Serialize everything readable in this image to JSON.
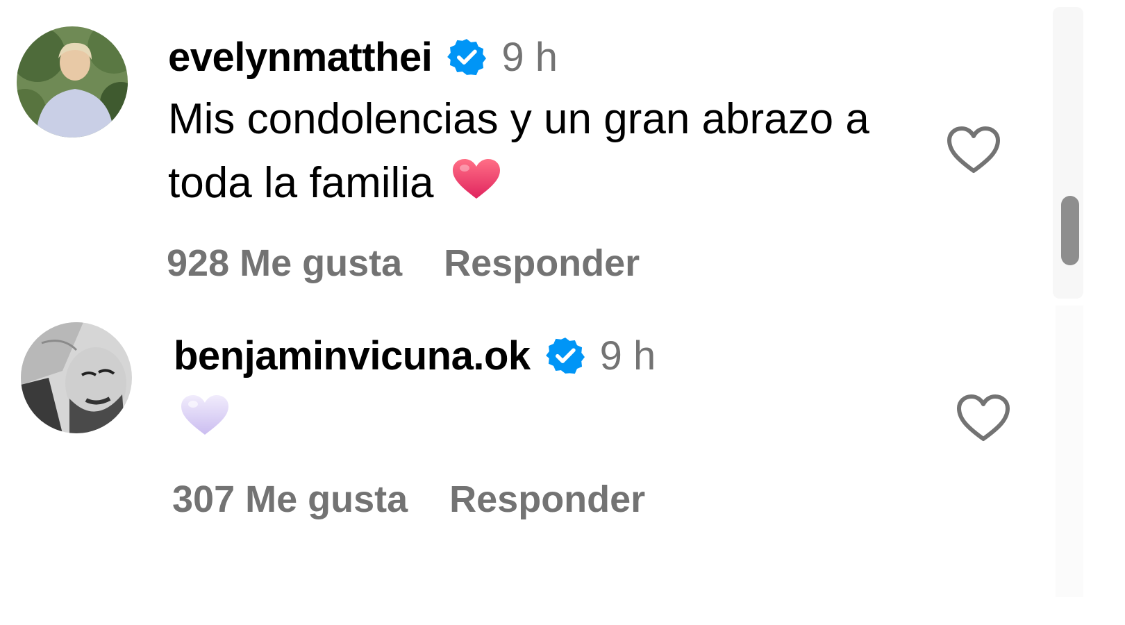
{
  "comments": [
    {
      "username": "evelynmatthei",
      "verified": true,
      "time": "9 h",
      "text": "Mis condolencias y un gran abrazo a toda la familia",
      "emoji": "red-heart",
      "likes_label": "928 Me gusta",
      "reply_label": "Responder",
      "avatar": "profile-photo"
    },
    {
      "username": "benjaminvicuna.ok",
      "verified": true,
      "time": "9 h",
      "text": "",
      "emoji": "light-purple-heart",
      "likes_label": "307 Me gusta",
      "reply_label": "Responder",
      "avatar": "profile-photo-grayscale"
    }
  ],
  "colors": {
    "verified_badge": "#0095F6",
    "secondary_text": "#737373",
    "red_heart": "#F23A5C",
    "purple_heart": "#D9CFF5"
  }
}
